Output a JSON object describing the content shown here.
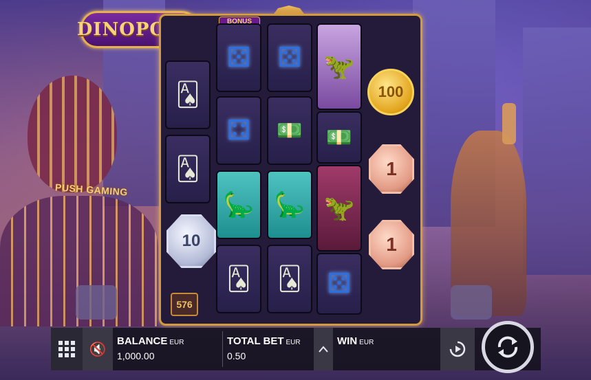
{
  "game": {
    "logo_text": "DINOPOLIS",
    "brand_sign": "PUSH GAMING",
    "bonus_label": "BONUS",
    "ways_count": "576"
  },
  "reels": {
    "col1": [
      "cards",
      "cards",
      "coin-silver-10",
      "cards"
    ],
    "col2": [
      "dice",
      "dice",
      "dino-brown",
      "cards"
    ],
    "col3": [
      "dice",
      "cash",
      "dino-brown",
      "cards"
    ],
    "col4": [
      "dino-purple-suit",
      "cash",
      "dino-red",
      "dice"
    ],
    "col5": [
      "coin-gold-100",
      "coin-bronze-1",
      "coin-bronze-1"
    ]
  },
  "coins": {
    "gold_value": "100",
    "silver_value": "10",
    "bronze_value_1": "1",
    "bronze_value_2": "1"
  },
  "controls": {
    "balance_label": "BALANCE",
    "balance_currency": "EUR",
    "balance_value": "1,000.00",
    "bet_label": "TOTAL BET",
    "bet_currency": "EUR",
    "bet_value": "0.50",
    "win_label": "WIN",
    "win_currency": "EUR",
    "menu_icon": "grid-menu-icon",
    "sound_icon": "speaker-muted-icon",
    "bet_up_icon": "chevron-up-icon",
    "autoplay_icon": "autoplay-icon",
    "spin_icon": "spin-arrows-icon"
  },
  "colors": {
    "accent_gold": "#d39a3e",
    "bar_bg": "#14121e"
  }
}
